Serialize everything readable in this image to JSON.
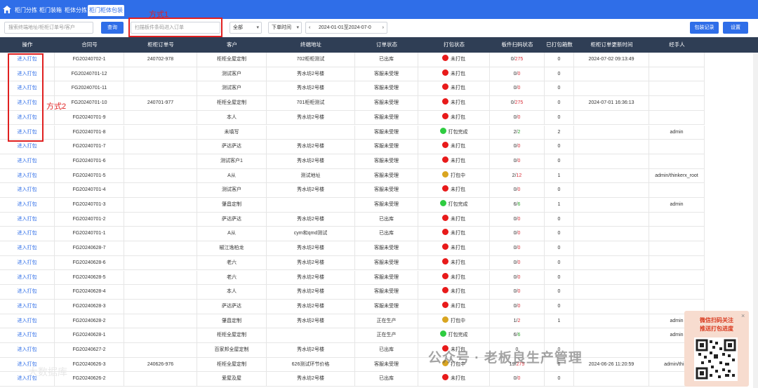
{
  "nav": {
    "tabs": [
      "柜门分拣",
      "柜门装箱",
      "柜体分拣",
      "柜门柜体包装"
    ],
    "active_index": 3
  },
  "toolbar": {
    "search_placeholder": "搜索终端地址/柜柜订单号/客户",
    "query_label": "查询",
    "scan_placeholder": "扫描板件条码进入订单",
    "status_select": "全部",
    "time_select": "下单时间",
    "date_range": "2024-01-01至2024-07-0",
    "records_label": "包装记录",
    "settings_label": "设置"
  },
  "annotations": {
    "method1": "方式1",
    "method2": "方式2"
  },
  "columns": [
    "操作",
    "合同号",
    "柜柜订单号",
    "客户",
    "终端地址",
    "订单状态",
    "打包状态",
    "板件扫码状态",
    "已打包箱数",
    "柜柜订单更新时间",
    "经手人"
  ],
  "colors": {
    "accent": "#2f6ee8",
    "header_bg": "#2f3e55",
    "status_red": "#e81a1a",
    "status_green": "#2ecc40",
    "status_yellow": "#d9a520",
    "annotation": "#e02020"
  },
  "rows": [
    {
      "op": "进入打包",
      "contract": "FG20240702-1",
      "order": "240702-978",
      "customer": "柜柜全屋定制",
      "address": "702柜柜测试",
      "status": "已出库",
      "pack_color": "#e81a1a",
      "pack": "未打包",
      "scan_done": "0",
      "scan_total": "275",
      "boxes": "0",
      "updated": "2024-07-02 09:13:49",
      "handler": ""
    },
    {
      "op": "进入打包",
      "contract": "FG20240701-12",
      "order": "",
      "customer": "测试客户",
      "address": "秀水坊2号楼",
      "status": "客服未受理",
      "pack_color": "#e81a1a",
      "pack": "未打包",
      "scan_done": "0",
      "scan_total": "0",
      "boxes": "0",
      "updated": "",
      "handler": ""
    },
    {
      "op": "进入打包",
      "contract": "FG20240701-11",
      "order": "",
      "customer": "测试客户",
      "address": "秀水坊2号楼",
      "status": "客服未受理",
      "pack_color": "#e81a1a",
      "pack": "未打包",
      "scan_done": "0",
      "scan_total": "0",
      "boxes": "0",
      "updated": "",
      "handler": ""
    },
    {
      "op": "进入打包",
      "contract": "FG20240701-10",
      "order": "240701-977",
      "customer": "柜柜全屋定制",
      "address": "701柜柜测试",
      "status": "客服未受理",
      "pack_color": "#e81a1a",
      "pack": "未打包",
      "scan_done": "0",
      "scan_total": "275",
      "boxes": "0",
      "updated": "2024-07-01 16:36:13",
      "handler": ""
    },
    {
      "op": "进入打包",
      "contract": "FG20240701-9",
      "order": "",
      "customer": "本人",
      "address": "秀水坊2号楼",
      "status": "客服未受理",
      "pack_color": "#e81a1a",
      "pack": "未打包",
      "scan_done": "0",
      "scan_total": "0",
      "boxes": "0",
      "updated": "",
      "handler": ""
    },
    {
      "op": "进入打包",
      "contract": "FG20240701-8",
      "order": "",
      "customer": "未填写",
      "address": "",
      "status": "客服未受理",
      "pack_color": "#2ecc40",
      "pack": "打包完成",
      "scan_done": "2",
      "scan_total": "2",
      "boxes": "2",
      "updated": "",
      "handler": "admin"
    },
    {
      "op": "进入打包",
      "contract": "FG20240701-7",
      "order": "",
      "customer": "萨达萨达",
      "address": "秀水坊2号楼",
      "status": "客服未受理",
      "pack_color": "#e81a1a",
      "pack": "未打包",
      "scan_done": "0",
      "scan_total": "0",
      "boxes": "0",
      "updated": "",
      "handler": ""
    },
    {
      "op": "进入打包",
      "contract": "FG20240701-6",
      "order": "",
      "customer": "测试客户1",
      "address": "秀水坊2号楼",
      "status": "客服未受理",
      "pack_color": "#e81a1a",
      "pack": "未打包",
      "scan_done": "0",
      "scan_total": "0",
      "boxes": "0",
      "updated": "",
      "handler": ""
    },
    {
      "op": "进入打包",
      "contract": "FG20240701-5",
      "order": "",
      "customer": "A从",
      "address": "测试地址",
      "status": "客服未受理",
      "pack_color": "#d9a520",
      "pack": "打包中",
      "scan_done": "2",
      "scan_total": "12",
      "boxes": "1",
      "updated": "",
      "handler": "admin/thinkerx_root"
    },
    {
      "op": "进入打包",
      "contract": "FG20240701-4",
      "order": "",
      "customer": "测试客户",
      "address": "秀水坊2号楼",
      "status": "客服未受理",
      "pack_color": "#e81a1a",
      "pack": "未打包",
      "scan_done": "0",
      "scan_total": "0",
      "boxes": "0",
      "updated": "",
      "handler": ""
    },
    {
      "op": "进入打包",
      "contract": "FG20240701-3",
      "order": "",
      "customer": "肇昌定制",
      "address": "",
      "status": "客服未受理",
      "pack_color": "#2ecc40",
      "pack": "打包完成",
      "scan_done": "6",
      "scan_total": "6",
      "boxes": "1",
      "updated": "",
      "handler": "admin"
    },
    {
      "op": "进入打包",
      "contract": "FG20240701-2",
      "order": "",
      "customer": "萨达萨达",
      "address": "秀水坊2号楼",
      "status": "已出库",
      "pack_color": "#e81a1a",
      "pack": "未打包",
      "scan_done": "0",
      "scan_total": "0",
      "boxes": "0",
      "updated": "",
      "handler": ""
    },
    {
      "op": "进入打包",
      "contract": "FG20240701-1",
      "order": "",
      "customer": "A从",
      "address": "cym和qmd测试",
      "status": "已出库",
      "pack_color": "#e81a1a",
      "pack": "未打包",
      "scan_done": "0",
      "scan_total": "0",
      "boxes": "0",
      "updated": "",
      "handler": ""
    },
    {
      "op": "进入打包",
      "contract": "FG20240628-7",
      "order": "",
      "customer": "椒江逸柏龙",
      "address": "秀水坊2号楼",
      "status": "客服未受理",
      "pack_color": "#e81a1a",
      "pack": "未打包",
      "scan_done": "0",
      "scan_total": "0",
      "boxes": "0",
      "updated": "",
      "handler": ""
    },
    {
      "op": "进入打包",
      "contract": "FG20240628-6",
      "order": "",
      "customer": "老六",
      "address": "秀水坊2号楼",
      "status": "客服未受理",
      "pack_color": "#e81a1a",
      "pack": "未打包",
      "scan_done": "0",
      "scan_total": "0",
      "boxes": "0",
      "updated": "",
      "handler": ""
    },
    {
      "op": "进入打包",
      "contract": "FG20240628-5",
      "order": "",
      "customer": "老六",
      "address": "秀水坊2号楼",
      "status": "客服未受理",
      "pack_color": "#e81a1a",
      "pack": "未打包",
      "scan_done": "0",
      "scan_total": "0",
      "boxes": "0",
      "updated": "",
      "handler": ""
    },
    {
      "op": "进入打包",
      "contract": "FG20240628-4",
      "order": "",
      "customer": "本人",
      "address": "秀水坊2号楼",
      "status": "客服未受理",
      "pack_color": "#e81a1a",
      "pack": "未打包",
      "scan_done": "0",
      "scan_total": "0",
      "boxes": "0",
      "updated": "",
      "handler": ""
    },
    {
      "op": "进入打包",
      "contract": "FG20240628-3",
      "order": "",
      "customer": "萨达萨达",
      "address": "秀水坊2号楼",
      "status": "客服未受理",
      "pack_color": "#e81a1a",
      "pack": "未打包",
      "scan_done": "0",
      "scan_total": "0",
      "boxes": "0",
      "updated": "",
      "handler": ""
    },
    {
      "op": "进入打包",
      "contract": "FG20240628-2",
      "order": "",
      "customer": "肇昌定制",
      "address": "秀水坊2号楼",
      "status": "正在生产",
      "pack_color": "#d9a520",
      "pack": "打包中",
      "scan_done": "1",
      "scan_total": "2",
      "boxes": "1",
      "updated": "",
      "handler": "admin"
    },
    {
      "op": "进入打包",
      "contract": "FG20240628-1",
      "order": "",
      "customer": "柜柜全屋定制",
      "address": "",
      "status": "正在生产",
      "pack_color": "#2ecc40",
      "pack": "打包完成",
      "scan_done": "6",
      "scan_total": "6",
      "boxes": "",
      "updated": "",
      "handler": "admin"
    },
    {
      "op": "进入打包",
      "contract": "FG20240627-2",
      "order": "",
      "customer": "百家邦全屋定制",
      "address": "秀水坊2号楼",
      "status": "已出库",
      "pack_color": "#e81a1a",
      "pack": "未打包",
      "scan_done": "0",
      "scan_total": "",
      "boxes": "0",
      "updated": "",
      "handler": ""
    },
    {
      "op": "进入打包",
      "contract": "FG20240626-3",
      "order": "240626-976",
      "customer": "柜柜全屋定制",
      "address": "626测试环节价格",
      "status": "客服未受理",
      "pack_color": "#d9a520",
      "pack": "打包中",
      "scan_done": "19",
      "scan_total": "275",
      "boxes": "6",
      "updated": "2024-06-26 11:20:59",
      "handler": "admin/think"
    },
    {
      "op": "进入打包",
      "contract": "FG20240626-2",
      "order": "",
      "customer": "爱屋及屋",
      "address": "秀水坊2号楼",
      "status": "已出库",
      "pack_color": "#e81a1a",
      "pack": "未打包",
      "scan_done": "0",
      "scan_total": "0",
      "boxes": "0",
      "updated": "",
      "handler": ""
    }
  ],
  "qr_panel": {
    "title_line1": "微信扫码关注",
    "title_line2": "推送打包进度",
    "close_glyph": "×"
  },
  "watermarks": {
    "wechat": "公众号 · 老板良生产管理",
    "corner": "大数据库"
  }
}
